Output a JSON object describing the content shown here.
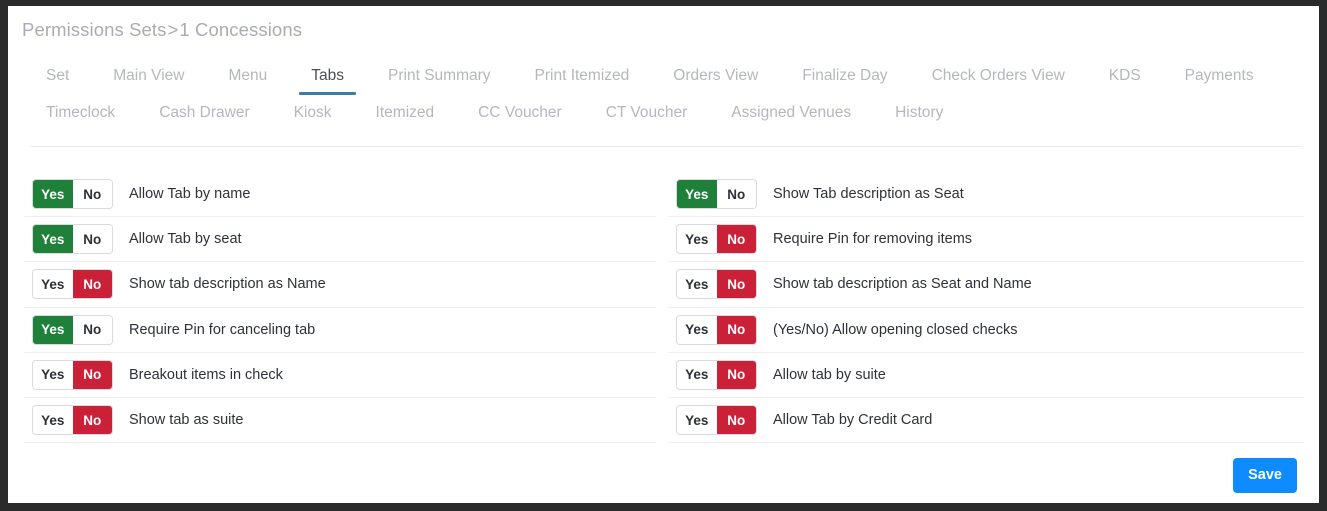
{
  "breadcrumb": {
    "parent": "Permissions Sets",
    "separator": ">",
    "current": "1 Concessions",
    "full": "Permissions Sets > 1 Concessions"
  },
  "colors": {
    "accent_blue": "#3d7ea6",
    "save_blue": "#0d8bff",
    "yes_green": "#1e8039",
    "no_red": "#ca2038",
    "tab_inactive": "#b4b7bd",
    "tab_active": "#4a4f57"
  },
  "tabs": {
    "active": "Tabs",
    "items": [
      {
        "label": "Set",
        "active": false
      },
      {
        "label": "Main View",
        "active": false
      },
      {
        "label": "Menu",
        "active": false
      },
      {
        "label": "Tabs",
        "active": true
      },
      {
        "label": "Print Summary",
        "active": false
      },
      {
        "label": "Print Itemized",
        "active": false
      },
      {
        "label": "Orders View",
        "active": false
      },
      {
        "label": "Finalize Day",
        "active": false
      },
      {
        "label": "Check Orders View",
        "active": false
      },
      {
        "label": "KDS",
        "active": false
      },
      {
        "label": "Payments",
        "active": false
      },
      {
        "label": "Timeclock",
        "active": false
      },
      {
        "label": "Cash Drawer",
        "active": false
      },
      {
        "label": "Kiosk",
        "active": false
      },
      {
        "label": "Itemized",
        "active": false
      },
      {
        "label": "CC Voucher",
        "active": false
      },
      {
        "label": "CT Voucher",
        "active": false
      },
      {
        "label": "Assigned Venues",
        "active": false
      },
      {
        "label": "History",
        "active": false
      }
    ]
  },
  "toggle": {
    "yes_label": "Yes",
    "no_label": "No"
  },
  "settings": {
    "left_column": [
      {
        "label": "Allow Tab by name",
        "value": "Yes"
      },
      {
        "label": "Allow Tab by seat",
        "value": "Yes"
      },
      {
        "label": "Show tab description as Name",
        "value": "No"
      },
      {
        "label": "Require Pin for canceling tab",
        "value": "Yes"
      },
      {
        "label": "Breakout items in check",
        "value": "No"
      },
      {
        "label": "Show tab as suite",
        "value": "No"
      }
    ],
    "right_column": [
      {
        "label": "Show Tab description as Seat",
        "value": "Yes"
      },
      {
        "label": "Require Pin for removing items",
        "value": "No"
      },
      {
        "label": "Show tab description as Seat and Name",
        "value": "No"
      },
      {
        "label": "(Yes/No) Allow opening closed checks",
        "value": "No"
      },
      {
        "label": "Allow tab by suite",
        "value": "No"
      },
      {
        "label": "Allow Tab by Credit Card",
        "value": "No"
      }
    ]
  },
  "footer": {
    "save_label": "Save"
  }
}
